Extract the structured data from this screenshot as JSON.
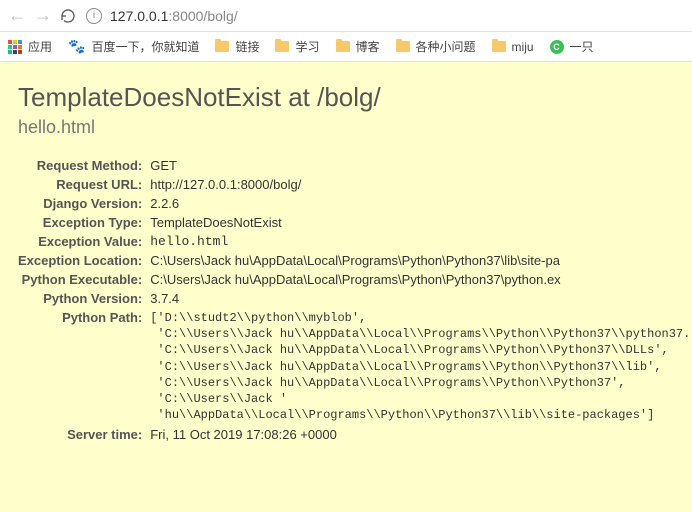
{
  "browser": {
    "address_host": "127.0.0.1",
    "address_port_path": ":8000/bolg/"
  },
  "bookmarks": {
    "apps_label": "应用",
    "items": [
      {
        "icon": "paw",
        "label": "百度一下，你就知道"
      },
      {
        "icon": "folder",
        "label": "链接"
      },
      {
        "icon": "folder",
        "label": "学习"
      },
      {
        "icon": "folder",
        "label": "博客"
      },
      {
        "icon": "folder",
        "label": "各种小问题"
      },
      {
        "icon": "folder",
        "label": "miju"
      },
      {
        "icon": "greenc",
        "label": "一只"
      }
    ]
  },
  "error": {
    "title": "TemplateDoesNotExist at /bolg/",
    "subtitle": "hello.html",
    "rows": {
      "request_method": {
        "label": "Request Method:",
        "value": "GET"
      },
      "request_url": {
        "label": "Request URL:",
        "value": "http://127.0.0.1:8000/bolg/"
      },
      "django_version": {
        "label": "Django Version:",
        "value": "2.2.6"
      },
      "exception_type": {
        "label": "Exception Type:",
        "value": "TemplateDoesNotExist"
      },
      "exception_value": {
        "label": "Exception Value:",
        "value": "hello.html"
      },
      "exception_location": {
        "label": "Exception Location:",
        "value": "C:\\Users\\Jack hu\\AppData\\Local\\Programs\\Python\\Python37\\lib\\site-pa"
      },
      "python_executable": {
        "label": "Python Executable:",
        "value": "C:\\Users\\Jack hu\\AppData\\Local\\Programs\\Python\\Python37\\python.ex"
      },
      "python_version": {
        "label": "Python Version:",
        "value": "3.7.4"
      },
      "python_path": {
        "label": "Python Path:",
        "value": "['D:\\\\studt2\\\\python\\\\myblob',\n 'C:\\\\Users\\\\Jack hu\\\\AppData\\\\Local\\\\Programs\\\\Python\\\\Python37\\\\python37.\n 'C:\\\\Users\\\\Jack hu\\\\AppData\\\\Local\\\\Programs\\\\Python\\\\Python37\\\\DLLs',\n 'C:\\\\Users\\\\Jack hu\\\\AppData\\\\Local\\\\Programs\\\\Python\\\\Python37\\\\lib',\n 'C:\\\\Users\\\\Jack hu\\\\AppData\\\\Local\\\\Programs\\\\Python\\\\Python37',\n 'C:\\\\Users\\\\Jack '\n 'hu\\\\AppData\\\\Local\\\\Programs\\\\Python\\\\Python37\\\\lib\\\\site-packages']"
      },
      "server_time": {
        "label": "Server time:",
        "value": "Fri, 11 Oct 2019 17:08:26 +0000"
      }
    }
  }
}
